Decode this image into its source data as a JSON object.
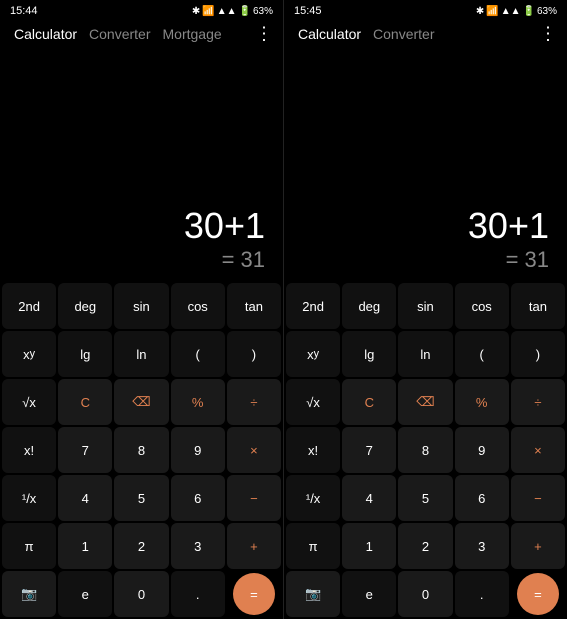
{
  "left": {
    "statusBar": {
      "time": "15:44",
      "battery": "63%"
    },
    "navTabs": [
      "Calculator",
      "Converter",
      "Mortgage"
    ],
    "activeTab": "Calculator",
    "display": {
      "expression": "30+1",
      "result": "= 31"
    },
    "buttons": [
      [
        "2nd",
        "deg",
        "sin",
        "cos",
        "tan"
      ],
      [
        "xʸ",
        "lg",
        "ln",
        "(",
        ")"
      ],
      [
        "√x",
        "C",
        "⌫",
        "%",
        "÷"
      ],
      [
        "x!",
        "7",
        "8",
        "9",
        "×"
      ],
      [
        "¹/x",
        "4",
        "5",
        "6",
        "−"
      ],
      [
        "π",
        "1",
        "2",
        "3",
        "+"
      ],
      [
        "📷",
        "e",
        "0",
        ".",
        "="
      ]
    ]
  },
  "right": {
    "statusBar": {
      "time": "15:45",
      "battery": "63%"
    },
    "navTabs": [
      "Calculator",
      "Converter"
    ],
    "activeTab": "Calculator",
    "display": {
      "expression": "30+1",
      "result": "= 31"
    },
    "buttons": [
      [
        "2nd",
        "deg",
        "sin",
        "cos",
        "tan"
      ],
      [
        "xʸ",
        "lg",
        "ln",
        "(",
        ")"
      ],
      [
        "√x",
        "C",
        "⌫",
        "%",
        "÷"
      ],
      [
        "x!",
        "7",
        "8",
        "9",
        "×"
      ],
      [
        "¹/x",
        "4",
        "5",
        "6",
        "−"
      ],
      [
        "π",
        "1",
        "2",
        "3",
        "+"
      ],
      [
        "📷",
        "e",
        "0",
        ".",
        "="
      ]
    ]
  },
  "labels": {
    "threeDots": "⋮"
  }
}
